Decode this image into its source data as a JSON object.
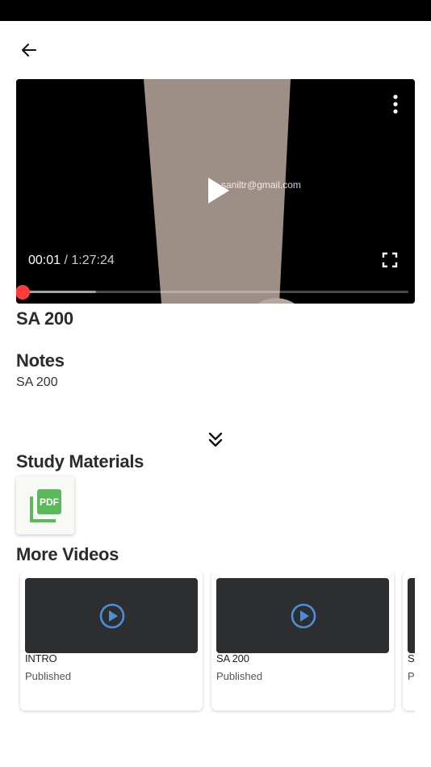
{
  "player": {
    "current_time": "00:01",
    "separator": "/",
    "duration": "1:27:24",
    "watermark": "saniltr@gmail.com",
    "progress_fraction": 0.0,
    "buffered_fraction": 0.19,
    "accent_color": "#ff3b3b"
  },
  "video": {
    "title": "SA 200"
  },
  "notes": {
    "heading": "Notes",
    "text": "SA 200"
  },
  "study_materials": {
    "heading": "Study Materials",
    "items": [
      {
        "icon": "pdf-icon",
        "label": "PDF",
        "color": "#5cb85c"
      }
    ]
  },
  "more_videos": {
    "heading": "More Videos",
    "items": [
      {
        "title": "INTRO",
        "status": "Published"
      },
      {
        "title": "SA 200",
        "status": "Published"
      },
      {
        "title": "SA",
        "status": "Pu"
      }
    ]
  },
  "icons": {
    "back": "arrow-left-icon",
    "menu": "more-vertical-icon",
    "play": "play-icon",
    "fullscreen": "fullscreen-icon",
    "expand": "chevron-double-down-icon",
    "card_play": "play-circle-icon"
  },
  "colors": {
    "play_circle": "#4a90d9",
    "card_thumb_bg": "#2d2e30"
  }
}
